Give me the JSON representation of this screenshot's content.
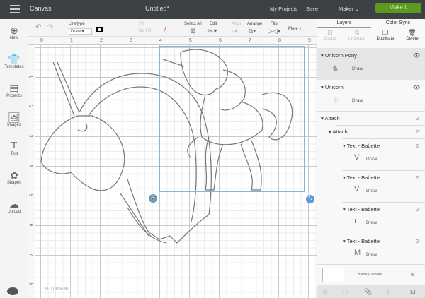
{
  "topbar": {
    "app": "Canvas",
    "title": "Untitled*",
    "my_projects": "My Projects",
    "save": "Save",
    "machine": "Maker",
    "make_it": "Make It"
  },
  "toolbar": {
    "linetype_label": "Linetype",
    "linetype_value": "Draw",
    "fill_label": "Fill",
    "fill_value": "No Fill",
    "select_all": "Select All",
    "edit": "Edit",
    "align": "Align",
    "arrange": "Arrange",
    "flip": "Flip",
    "more": "More ▾"
  },
  "sidebar": [
    {
      "label": "New",
      "icon": "⊕"
    },
    {
      "label": "Templates",
      "icon": "👕"
    },
    {
      "label": "Projects",
      "icon": "▤"
    },
    {
      "label": "Images",
      "icon": "🖼"
    },
    {
      "label": "Text",
      "icon": "T"
    },
    {
      "label": "Shapes",
      "icon": "✿"
    },
    {
      "label": "Upload",
      "icon": "☁"
    }
  ],
  "ruler": {
    "top": [
      "0",
      "1",
      "2",
      "3",
      "4",
      "5",
      "6",
      "7",
      "8",
      "9"
    ],
    "left": [
      "1",
      "2",
      "3",
      "4",
      "5",
      "6",
      "7",
      "8"
    ]
  },
  "zoom": "100%",
  "panel": {
    "tabs": [
      "Layers",
      "Color Sync"
    ],
    "actions": [
      "Group",
      "UnGroup",
      "Duplicate",
      "Delete"
    ],
    "layers": [
      {
        "name": "Unicorn Pony",
        "sub": "Draw"
      },
      {
        "name": "Unicorn",
        "sub": "Draw"
      },
      {
        "name": "Attach"
      },
      {
        "name": "Attach"
      },
      {
        "name": "Text - Babette",
        "sub": "Draw",
        "glyph": "V"
      },
      {
        "name": "Text - Babette",
        "sub": "Draw",
        "glyph": "V"
      },
      {
        "name": "Text - Babette",
        "sub": "Draw",
        "glyph": "ı"
      },
      {
        "name": "Text - Babette",
        "sub": "Draw",
        "glyph": "M"
      }
    ],
    "blank_canvas": "Blank Canvas"
  }
}
